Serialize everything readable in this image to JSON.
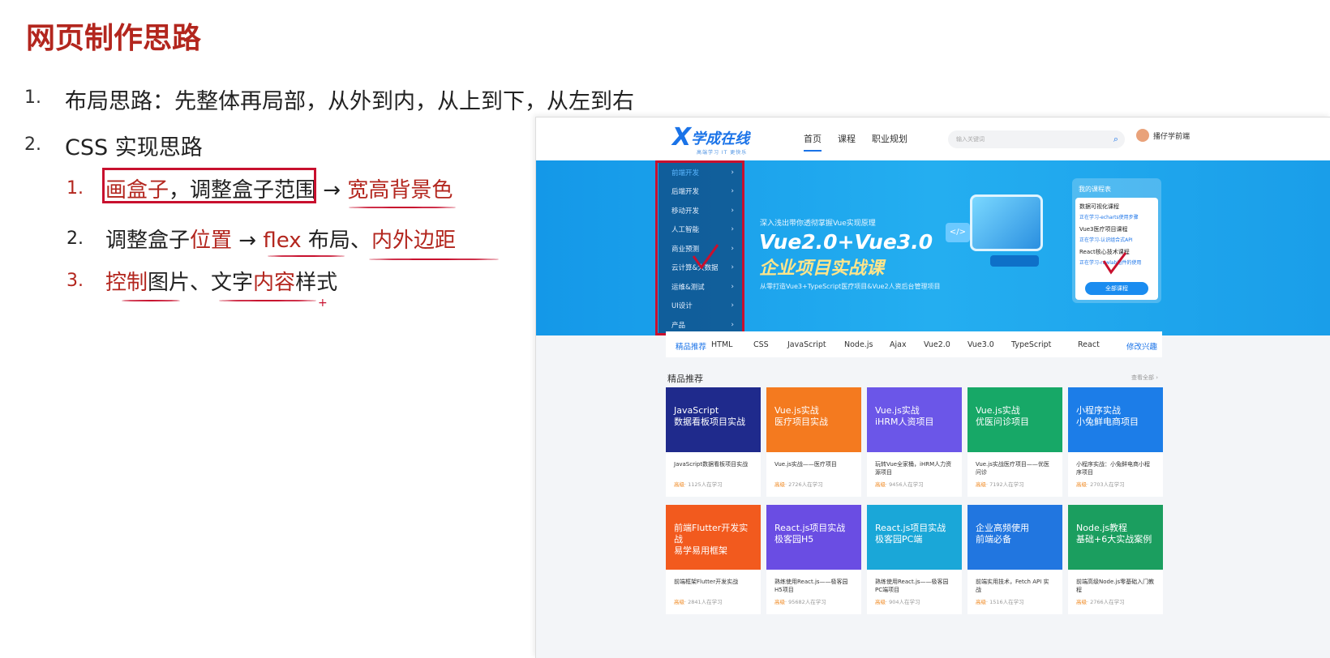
{
  "slide": {
    "title": "网页制作思路",
    "points": [
      {
        "num": "1.",
        "text": "布局思路：先整体再局部，从外到内，从上到下，从左到右"
      },
      {
        "num": "2.",
        "text": "CSS 实现思路"
      }
    ],
    "subpoints": [
      {
        "num": "1.",
        "parts": [
          "画盒子",
          "，调整盒子范围",
          " → ",
          "宽高背景色"
        ]
      },
      {
        "num": "2.",
        "parts": [
          "调整盒子",
          "位置",
          " → ",
          "flex",
          " 布局、",
          "内外边距"
        ]
      },
      {
        "num": "3.",
        "parts": [
          "控制",
          "图片、",
          "文字",
          "内容",
          "样式"
        ]
      }
    ],
    "annot_plus": "+"
  },
  "site": {
    "logo_mark": "X",
    "logo_text": "学成在线",
    "logo_slogan": "高端学习 IT 更快乐",
    "nav": [
      "首页",
      "课程",
      "职业规划"
    ],
    "search_placeholder": "输入关键词",
    "username": "播仔学前端",
    "side_menu": [
      "前端开发",
      "后端开发",
      "移动开发",
      "人工智能",
      "商业预测",
      "云计算&大数据",
      "运维&测试",
      "UI设计",
      "产品"
    ],
    "banner": {
      "sub": "深入浅出带你透彻掌握Vue实现原理",
      "title1": "Vue2.0+Vue3.0",
      "title2": "企业项目实战课",
      "desc": "从零打造Vue3+TypeScript医疗项目&Vue2人资后台管理项目"
    },
    "my_courses": {
      "header": "我的课程表",
      "items": [
        {
          "name": "数据可视化课程",
          "status": "正在学习-echarts使用步骤"
        },
        {
          "name": "Vue3医疗项目课程",
          "status": "正在学习-认识组合式API"
        },
        {
          "name": "React核心技术课程",
          "status": "正在学习-rawlab组件的使用"
        }
      ],
      "button": "全部课程"
    },
    "tags": [
      "精品推荐",
      "HTML",
      "CSS",
      "JavaScript",
      "Node.js",
      "Ajax",
      "Vue2.0",
      "Vue3.0",
      "TypeScript",
      "React",
      "修改兴趣"
    ],
    "section_title": "精品推荐",
    "section_more": "查看全部 ›",
    "courses": [
      {
        "img_text": [
          "JavaScript",
          "数据看板项目实战"
        ],
        "title": "JavaScript数据看板项目实战",
        "level": "高级",
        "count": "· 1125人在学习",
        "color": "#1f2a8c"
      },
      {
        "img_text": [
          "Vue.js实战",
          "医疗项目实战"
        ],
        "title": "Vue.js实战——医疗项目",
        "level": "高级",
        "count": "· 2726人在学习",
        "color": "#f47a1f"
      },
      {
        "img_text": [
          "Vue.js实战",
          "iHRM人资项目"
        ],
        "title": "玩转Vue全家桶，iHRM人力资源项目",
        "level": "高级",
        "count": "· 9456人在学习",
        "color": "#6b56e8"
      },
      {
        "img_text": [
          "Vue.js实战",
          "优医问诊项目"
        ],
        "title": "Vue.js实战医疗项目——优医问诊",
        "level": "高级",
        "count": "· 7192人在学习",
        "color": "#17a867"
      },
      {
        "img_text": [
          "小程序实战",
          "小兔鲜电商项目"
        ],
        "title": "小程序实战：小兔鲜电商小程序项目",
        "level": "高级",
        "count": "· 2703人在学习",
        "color": "#1c7de8"
      },
      {
        "img_text": [
          "前端Flutter开发实战",
          "易学易用框架"
        ],
        "title": "前端框架Flutter开发实战",
        "level": "高级",
        "count": "· 2841人在学习",
        "color": "#f25a1e"
      },
      {
        "img_text": [
          "React.js项目实战",
          "极客园H5"
        ],
        "title": "熟练使用React.js——极客园H5项目",
        "level": "高级",
        "count": "· 95682人在学习",
        "color": "#6a4de3"
      },
      {
        "img_text": [
          "React.js项目实战",
          "极客园PC端"
        ],
        "title": "熟练使用React.js——极客园PC端项目",
        "level": "高级",
        "count": "· 904人在学习",
        "color": "#1aa7d8"
      },
      {
        "img_text": [
          "企业高频使用",
          "前端必备"
        ],
        "title": "前端实用技术，Fetch API 实战",
        "level": "高级",
        "count": "· 1516人在学习",
        "color": "#2176e0"
      },
      {
        "img_text": [
          "Node.js教程",
          "基础+6大实战案例"
        ],
        "title": "前端高级Node.js零基础入门教程",
        "level": "高级",
        "count": "· 2766人在学习",
        "color": "#1b9e5f"
      }
    ]
  }
}
